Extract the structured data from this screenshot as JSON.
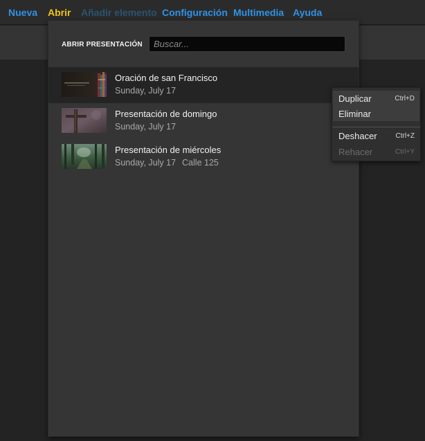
{
  "menubar": {
    "items": [
      {
        "label": "Nueva",
        "state": "normal"
      },
      {
        "label": "Abrir",
        "state": "active"
      },
      {
        "label": "Añadir elemento",
        "state": "disabled"
      },
      {
        "label": "Configuración",
        "state": "normal"
      },
      {
        "label": "Multimedia",
        "state": "normal"
      },
      {
        "label": "Ayuda",
        "state": "normal"
      }
    ]
  },
  "open_panel": {
    "title": "ABRIR PRESENTACIÓN",
    "search": {
      "placeholder": "Buscar...",
      "value": ""
    },
    "items": [
      {
        "title": "Oración de san Francisco",
        "date": "Sunday, July 17",
        "place": "",
        "thumbnail": "dark-slide-with-stained-glass",
        "selected": true
      },
      {
        "title": "Presentación de domingo",
        "date": "Sunday, July 17",
        "place": "",
        "thumbnail": "wooden-cross",
        "selected": false
      },
      {
        "title": "Presentación de miércoles",
        "date": "Sunday, July 17",
        "place": "Calle 125",
        "thumbnail": "forest-path",
        "selected": false
      }
    ]
  },
  "context_menu": {
    "items": [
      {
        "label": "Duplicar",
        "shortcut": "Ctrl+D",
        "enabled": true
      },
      {
        "label": "Eliminar",
        "shortcut": "",
        "enabled": true
      },
      {
        "label": "Deshacer",
        "shortcut": "Ctrl+Z",
        "enabled": true
      },
      {
        "label": "Rehacer",
        "shortcut": "Ctrl+Y",
        "enabled": false
      }
    ]
  },
  "colors": {
    "menu_link": "#2f93e6",
    "menu_active": "#f2c614",
    "menu_disabled": "#2a5472",
    "panel_bg": "#353535",
    "selected_row_bg": "#242424"
  }
}
